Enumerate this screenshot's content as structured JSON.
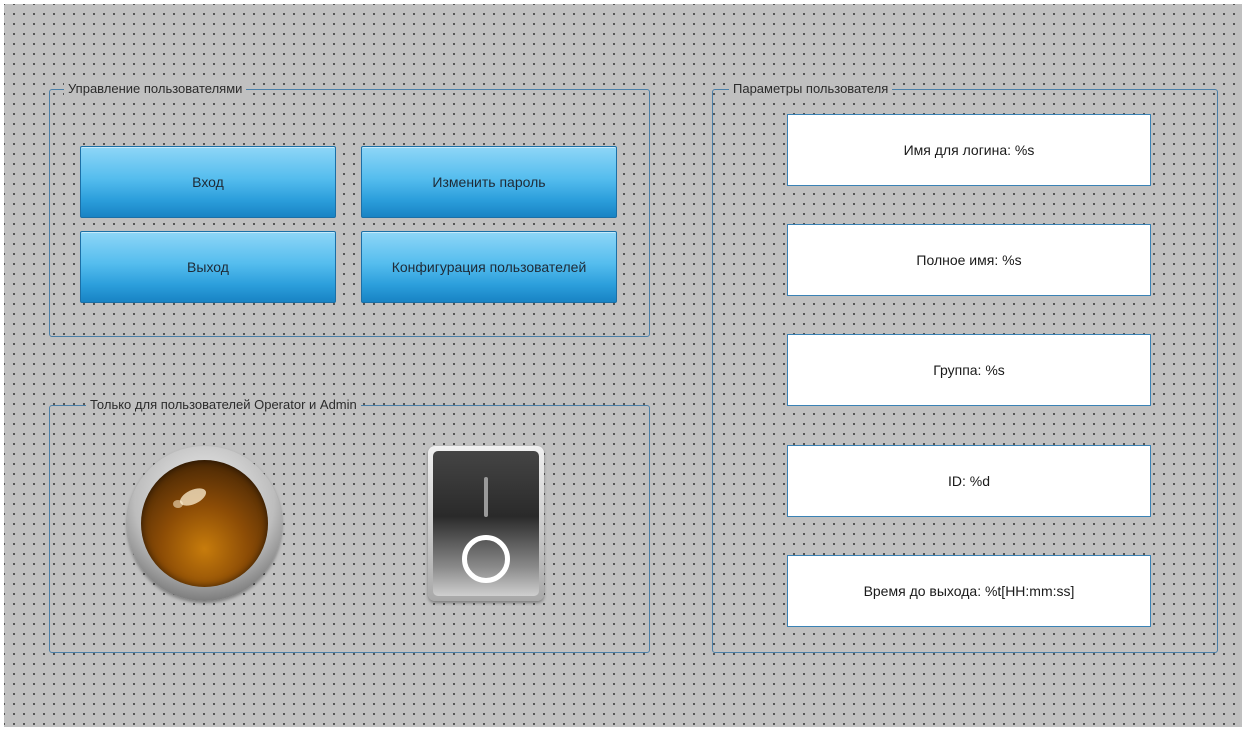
{
  "user_management": {
    "title": "Управление пользователями",
    "login_label": "Вход",
    "change_password_label": "Изменить пароль",
    "logout_label": "Выход",
    "user_config_label": "Конфигурация пользователей"
  },
  "operator_admin": {
    "title": "Только для пользователей Operator и Admin",
    "lamp_icon": "indicator-lamp-icon",
    "switch_icon": "toggle-switch-icon"
  },
  "user_params": {
    "title": "Параметры пользователя",
    "fields": [
      "Имя для логина: %s",
      "Полное имя: %s",
      "Группа: %s",
      "ID: %d",
      "Время до выхода: %t[HH:mm:ss]"
    ]
  },
  "colors": {
    "canvas": "#c0c0c0",
    "group_border": "#4a7fa8",
    "button_blue": "#2c9fdc",
    "lamp_amber": "#8c4c06"
  }
}
